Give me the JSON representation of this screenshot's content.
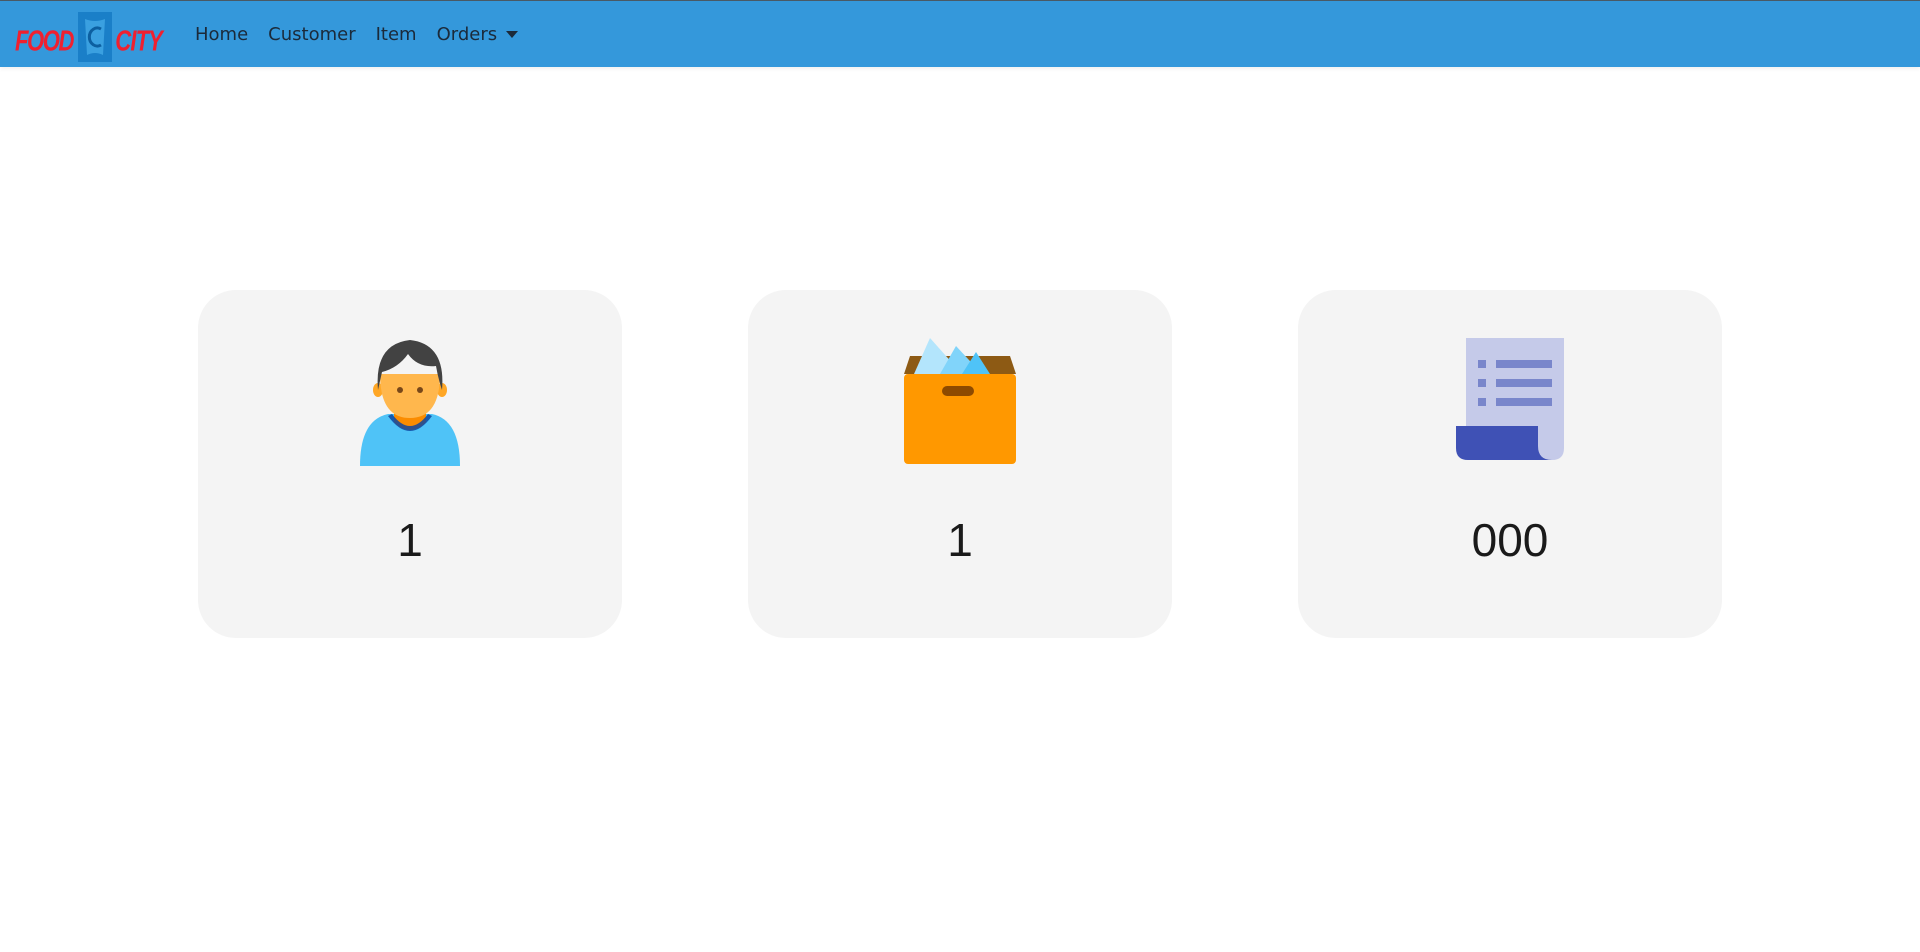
{
  "brand": {
    "logo_text_left": "FOOD",
    "logo_text_right": "CITY"
  },
  "nav": {
    "items": [
      {
        "label": "Home"
      },
      {
        "label": "Customer"
      },
      {
        "label": "Item"
      },
      {
        "label": "Orders"
      }
    ]
  },
  "cards": [
    {
      "icon": "customer-icon",
      "value": "1"
    },
    {
      "icon": "item-box-icon",
      "value": "1"
    },
    {
      "icon": "order-receipt-icon",
      "value": "000"
    }
  ],
  "colors": {
    "navbar": "#3498db",
    "card": "#f4f4f4",
    "logo_red": "#f0202f"
  }
}
